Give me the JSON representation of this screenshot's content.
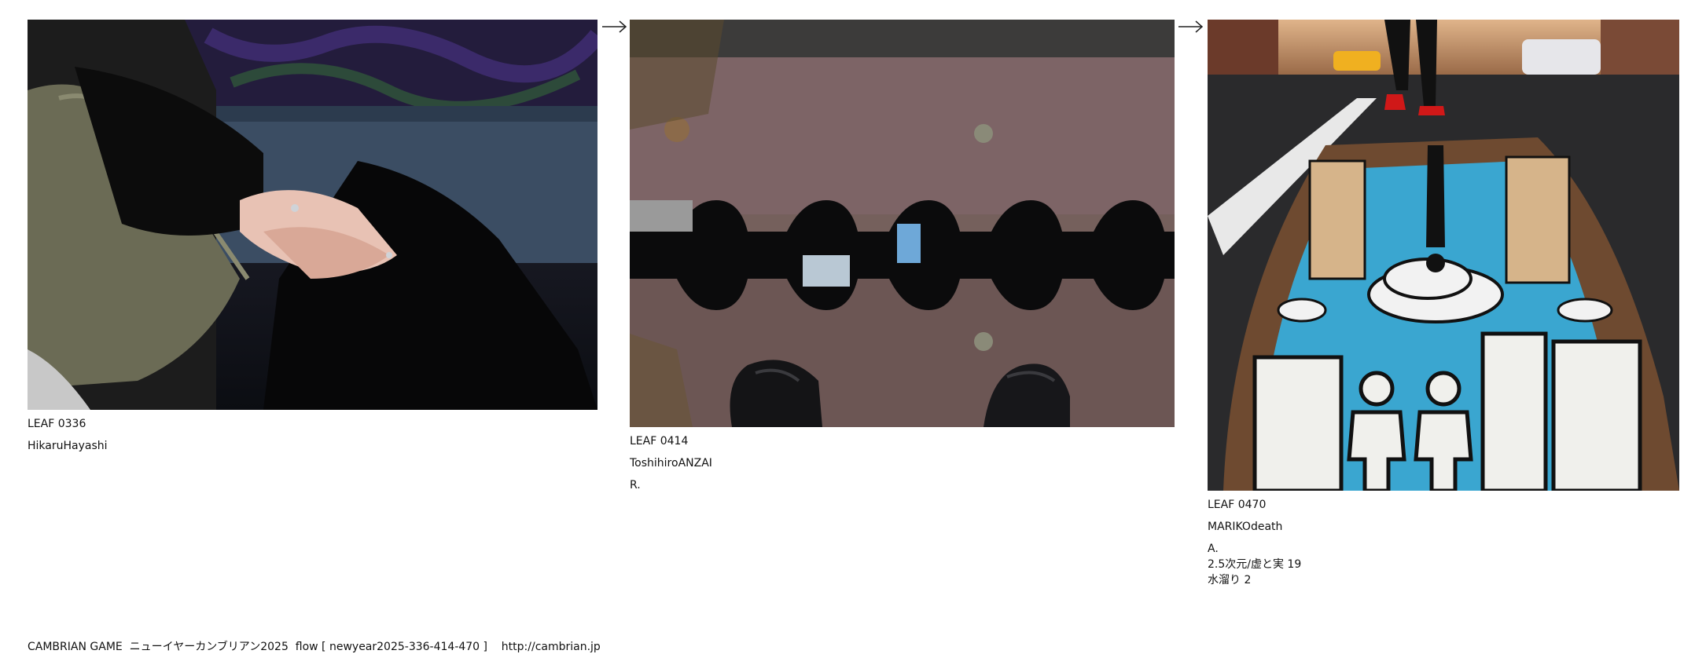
{
  "leaves": [
    {
      "id": "LEAF 0336",
      "author": "HikaruHayashi",
      "notes": []
    },
    {
      "id": "LEAF 0414",
      "author": "ToshihiroANZAI",
      "notes": [
        "R."
      ]
    },
    {
      "id": "LEAF 0470",
      "author": "MARIKOdeath",
      "notes": [
        "A.",
        "2.5次元/虚と実 19",
        "水溜り 2"
      ]
    }
  ],
  "arrow_icon": "right-arrow-icon",
  "footer": "CAMBRIAN GAME  ニューイヤーカンブリアン2025  flow [ newyear2025-336-414-470 ]    http://cambrian.jp"
}
